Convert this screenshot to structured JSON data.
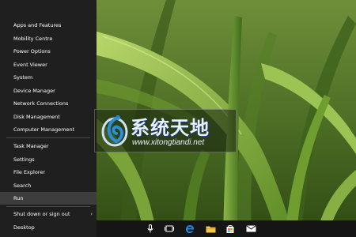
{
  "menu": {
    "group1": [
      {
        "label": "Apps and Features"
      },
      {
        "label": "Mobility Centre"
      },
      {
        "label": "Power Options"
      },
      {
        "label": "Event Viewer"
      },
      {
        "label": "System"
      },
      {
        "label": "Device Manager"
      },
      {
        "label": "Network Connections"
      },
      {
        "label": "Disk Management"
      },
      {
        "label": "Computer Management"
      }
    ],
    "group2": [
      {
        "label": "Task Manager"
      },
      {
        "label": "Settings"
      },
      {
        "label": "File Explorer"
      },
      {
        "label": "Search"
      },
      {
        "label": "Run"
      }
    ],
    "group3": [
      {
        "label": "Shut down or sign out"
      },
      {
        "label": "Desktop"
      }
    ],
    "selected": "Run"
  },
  "watermark": {
    "title": "系统天地",
    "url": "www.xitongtiandi.net"
  },
  "taskbar": {
    "icons": [
      "microphone-icon",
      "task-view-icon",
      "edge-icon",
      "file-explorer-icon",
      "store-icon",
      "mail-icon"
    ]
  },
  "colors": {
    "menu_bg": "#1f1f1f",
    "menu_selected": "#3d3d3d",
    "taskbar_bg": "#151515",
    "edge_blue": "#1e88e5",
    "folder_yellow": "#f2c94c"
  }
}
